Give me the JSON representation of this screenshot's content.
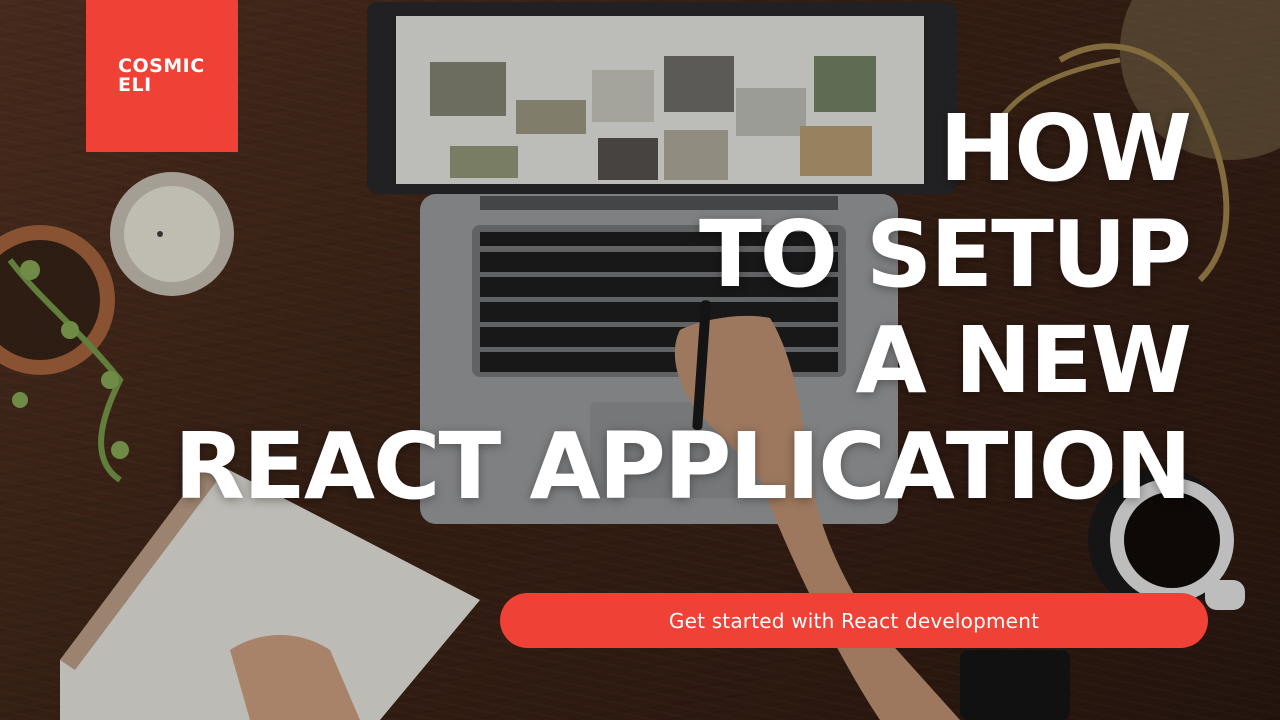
{
  "brand": {
    "line1": "COSMIC",
    "line2": "ELI",
    "color": "#ef4135"
  },
  "headline": {
    "lines": [
      "HOW",
      "TO SETUP",
      "A NEW",
      "REACT APPLICATION"
    ]
  },
  "cta": {
    "label": "Get started with React development",
    "color": "#ef4135"
  },
  "photo_elements": [
    "laptop",
    "keyboard",
    "hand-with-pen",
    "candle",
    "potted-plant",
    "notebook",
    "coffee-cup",
    "desk-lamp"
  ]
}
